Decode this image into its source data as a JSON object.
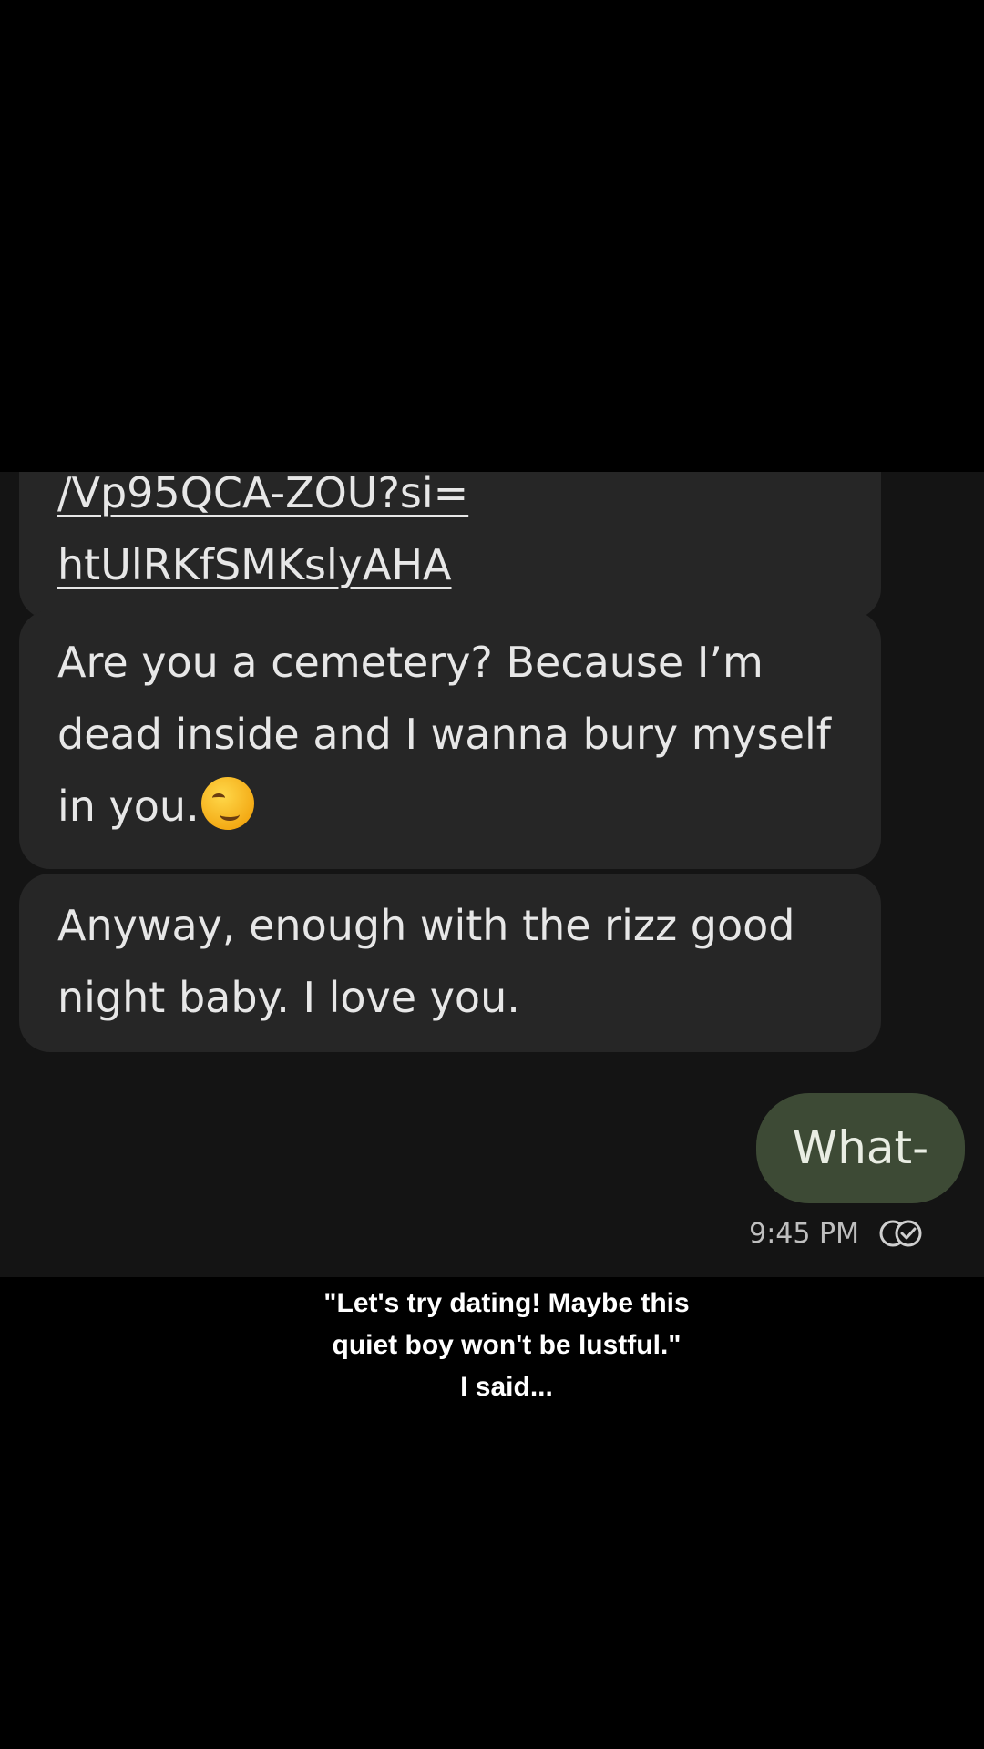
{
  "messages": {
    "link": {
      "line1": "/Vp95QCA-ZOU?si=",
      "line2": "htUlRKfSMKslyAHA"
    },
    "cemetery": {
      "line1": "Are you a cemetery? Because I’m",
      "line2": "dead inside and I wanna bury myself",
      "line3": "in you.",
      "emoji": "smirking-face-emoji"
    },
    "anyway": {
      "line1": "Anyway, enough with the rizz good",
      "line2": "night baby. I love you."
    },
    "outgoing": {
      "text": "What-",
      "time": "9:45 PM",
      "status_icon": "read-receipt-icon"
    }
  },
  "colors": {
    "background": "#000000",
    "chat_background": "#141414",
    "incoming_bubble": "#262626",
    "outgoing_bubble": "#3d4a35",
    "text": "#e7e7e7"
  },
  "caption": {
    "line1": "\"Let's try dating! Maybe this",
    "line2": "quiet boy won't be lustful.\"",
    "line3": "I said..."
  }
}
